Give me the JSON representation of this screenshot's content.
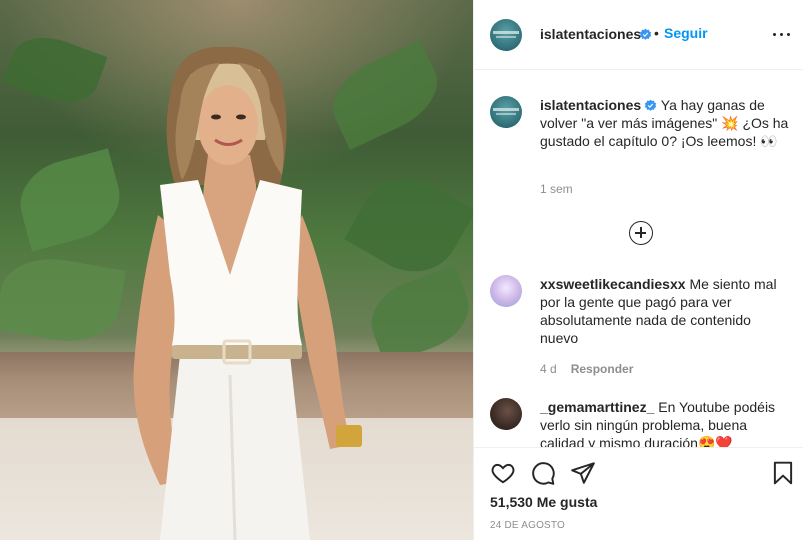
{
  "post": {
    "username": "islatentaciones",
    "follow_label": "Seguir",
    "separator": "•",
    "caption": "Ya hay ganas de volver \"a ver más imágenes\" 💥 ¿Os ha gustado el capítulo 0? ¡Os leemos! 👀",
    "caption_time": "1 sem",
    "likes": "51,530 Me gusta",
    "date": "24 DE AGOSTO"
  },
  "comments": [
    {
      "username": "xxsweetlikecandiesxx",
      "text": "Me siento mal por la gente que pagó para ver absolutamente nada de contenido nuevo",
      "time": "4 d",
      "reply_label": "Responder"
    },
    {
      "username": "_gemamarttinez_",
      "text": "En Youtube podéis verlo sin ningún problema, buena calidad y mismo duración😍❤️"
    }
  ],
  "colors": {
    "accent": "#0095f6",
    "verified": "#3897f0",
    "text": "#262626",
    "muted": "#8e8e8e",
    "divider": "#efefef"
  },
  "icons": [
    "verified-badge-icon",
    "more-options-icon",
    "load-more-icon",
    "heart-icon",
    "comment-icon",
    "share-icon",
    "bookmark-icon"
  ]
}
